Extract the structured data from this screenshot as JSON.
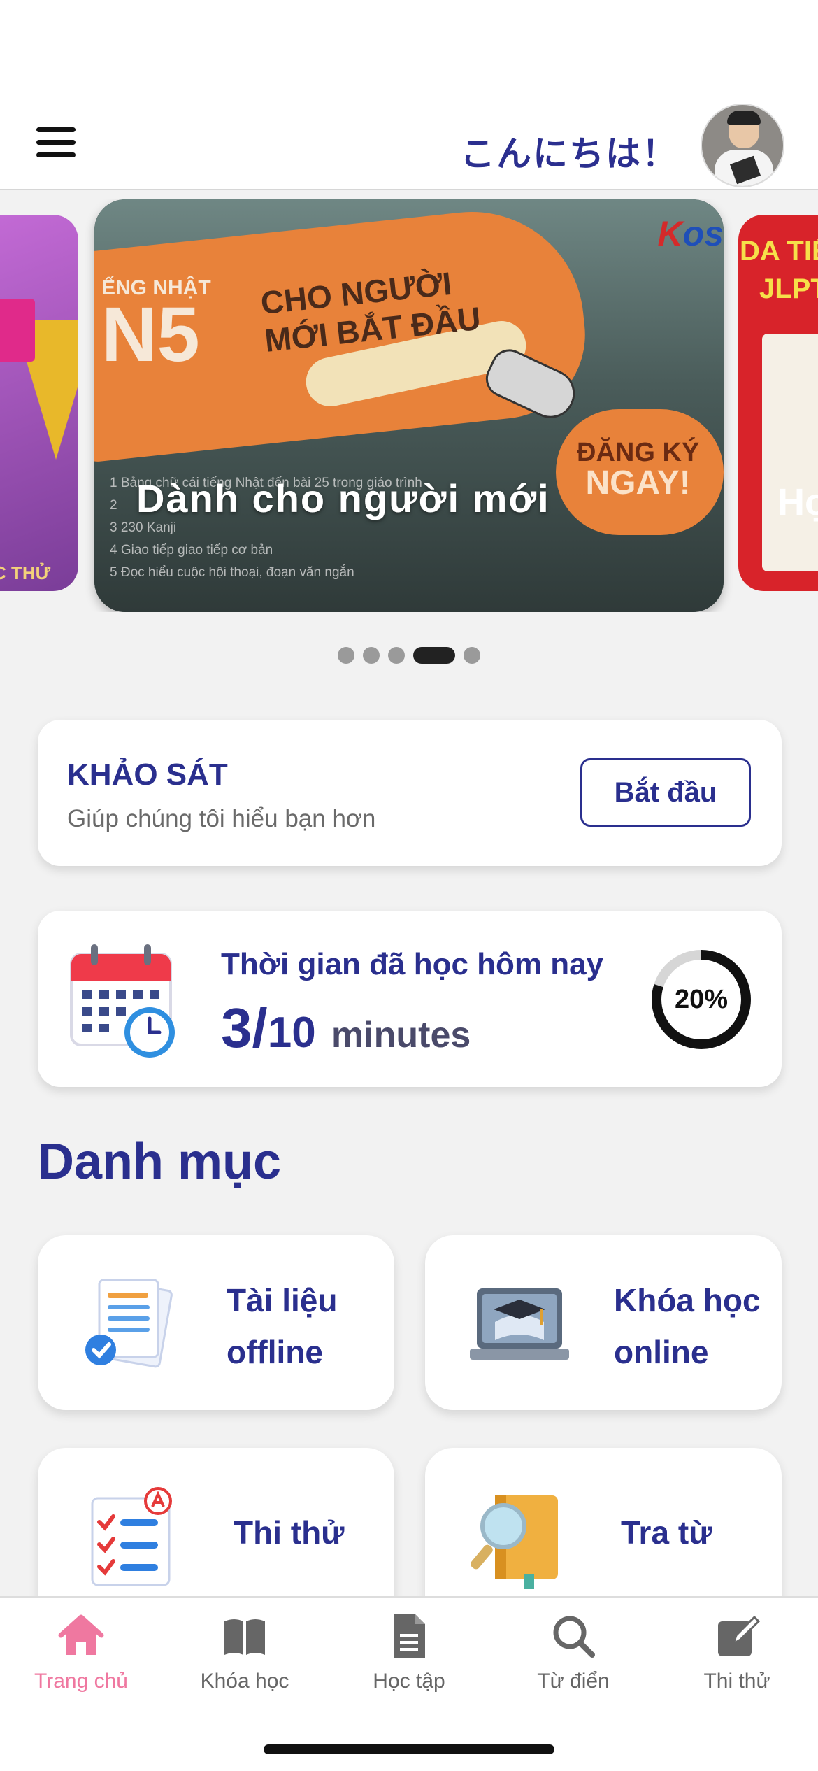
{
  "header": {
    "greeting": "こんにちは！"
  },
  "carousel": {
    "active_caption": "Dành cho người mới",
    "left_slide_tag": "C THỬ",
    "main_slide": {
      "n5_prefix": "ẾNG NHẬT",
      "n5": "N5",
      "promo_line1": "CHO NGƯỜI",
      "promo_line2": "MỚI BẮT ĐẦU",
      "logo_k": "K",
      "logo_rest": "os",
      "cta_line1": "ĐĂNG KÝ",
      "cta_line2": "NGAY!",
      "list_items": [
        "1  Bảng chữ cái tiếng Nhật đến bài 25 trong giáo trình",
        "2  ",
        "3  230 Kanji",
        "4  Giao tiếp giao tiếp cơ bản",
        "5  Đọc hiểu cuộc hội thoại, đoạn văn ngắn"
      ]
    },
    "right_slide": {
      "line1": "DA TIẾ",
      "line2": "JLPT",
      "caption": "Họ"
    },
    "dots_total": 5,
    "dots_active_index": 3
  },
  "survey": {
    "title": "KHẢO SÁT",
    "subtitle": "Giúp chúng tôi hiểu bạn hơn",
    "button_label": "Bắt đầu"
  },
  "study_time": {
    "title": "Thời gian đã học hôm nay",
    "done": "3/",
    "total": "10",
    "unit": "minutes",
    "progress_label": "20%",
    "progress_fraction": 0.2
  },
  "categories": {
    "title": "Danh mục",
    "items": [
      {
        "line1": "Tài liệu",
        "line2": "offline"
      },
      {
        "line1": "Khóa học",
        "line2": "online"
      },
      {
        "line1": "Thi thử"
      },
      {
        "line1": "Tra từ"
      }
    ]
  },
  "tabbar": {
    "tabs": [
      {
        "label": "Trang chủ",
        "icon": "home-icon"
      },
      {
        "label": "Khóa học",
        "icon": "book-icon"
      },
      {
        "label": "Học tập",
        "icon": "document-icon"
      },
      {
        "label": "Từ điển",
        "icon": "search-icon"
      },
      {
        "label": "Thi thử",
        "icon": "edit-icon"
      }
    ],
    "active_index": 0
  },
  "colors": {
    "brand_navy": "#2a2f8e",
    "active_tab_pink": "#ef78a0",
    "tab_inactive": "#666666"
  }
}
